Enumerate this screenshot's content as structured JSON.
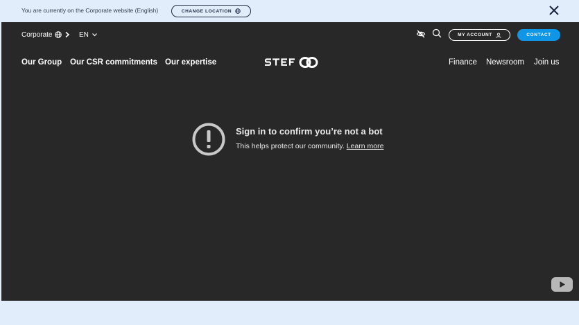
{
  "banner": {
    "text": "You are currently on the Corporate website (English)",
    "change_location_label": "CHANGE LOCATION",
    "icons": {
      "globe": "globe-icon",
      "close": "close-icon"
    }
  },
  "header": {
    "corporate_label": "Corporate",
    "language_label": "EN",
    "my_account_label": "MY ACCOUNT",
    "contact_label": "CONTACT",
    "logo_text": "stef",
    "nav_left": [
      "Our Group",
      "Our CSR commitments",
      "Our expertise"
    ],
    "nav_right": [
      "Finance",
      "Newsroom",
      "Join us"
    ],
    "icons": {
      "accessibility": "eye-off-icon",
      "search": "search-icon",
      "user": "user-icon"
    }
  },
  "video": {
    "title": "Sign in to confirm you’re not a bot",
    "subtitle": "This helps protect our community.",
    "learn_more_label": "Learn more",
    "icons": {
      "warning": "exclamation-circle-icon",
      "play": "youtube-play-icon"
    }
  },
  "colors": {
    "banner_bg": "#e1edfb",
    "panel_bg": "#282828",
    "contact_bg": "#0f96e6",
    "text_light": "#ffffff"
  }
}
